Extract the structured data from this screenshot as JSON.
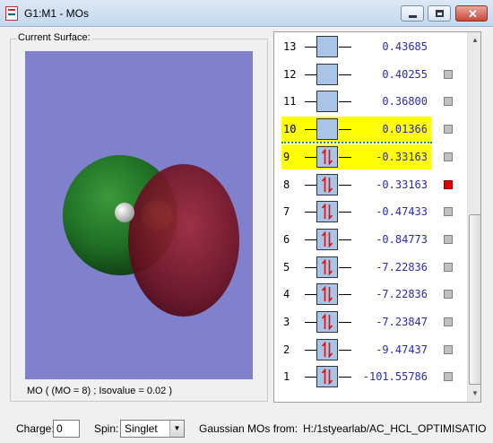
{
  "window": {
    "title": "G1:M1 - MOs"
  },
  "surface": {
    "legend": "Current Surface:",
    "caption": "MO ( (MO = 8) ; Isovalue = 0.02 )",
    "background_color": "#8080cc"
  },
  "orbitals": [
    {
      "num": "13",
      "energy": "0.43685",
      "occupied": false,
      "highlight": false,
      "selected": false,
      "marker": false
    },
    {
      "num": "12",
      "energy": "0.40255",
      "occupied": false,
      "highlight": false,
      "selected": false,
      "marker": true
    },
    {
      "num": "11",
      "energy": "0.36800",
      "occupied": false,
      "highlight": false,
      "selected": false,
      "marker": true
    },
    {
      "num": "10",
      "energy": "0.01366",
      "occupied": false,
      "highlight": true,
      "selected": false,
      "marker": true
    },
    {
      "num": "9",
      "energy": "-0.33163",
      "occupied": true,
      "highlight": true,
      "selected": false,
      "marker": true
    },
    {
      "num": "8",
      "energy": "-0.33163",
      "occupied": true,
      "highlight": false,
      "selected": true,
      "marker": true
    },
    {
      "num": "7",
      "energy": "-0.47433",
      "occupied": true,
      "highlight": false,
      "selected": false,
      "marker": true
    },
    {
      "num": "6",
      "energy": "-0.84773",
      "occupied": true,
      "highlight": false,
      "selected": false,
      "marker": true
    },
    {
      "num": "5",
      "energy": "-7.22836",
      "occupied": true,
      "highlight": false,
      "selected": false,
      "marker": true
    },
    {
      "num": "4",
      "energy": "-7.22836",
      "occupied": true,
      "highlight": false,
      "selected": false,
      "marker": true
    },
    {
      "num": "3",
      "energy": "-7.23847",
      "occupied": true,
      "highlight": false,
      "selected": false,
      "marker": true
    },
    {
      "num": "2",
      "energy": "-9.47437",
      "occupied": true,
      "highlight": false,
      "selected": false,
      "marker": true
    },
    {
      "num": "1",
      "energy": "-101.55786",
      "occupied": true,
      "highlight": false,
      "selected": false,
      "marker": true
    }
  ],
  "footer": {
    "charge_label": "Charge:",
    "charge_value": "0",
    "spin_label": "Spin:",
    "spin_value": "Singlet",
    "source_label": "Gaussian MOs from:",
    "source_path": "H:/1styearlab/AC_HCL_OPTIMISATIO"
  },
  "colors": {
    "highlight": "#ffff00",
    "energy_text": "#2a2ab8",
    "selected_marker": "#e00000",
    "orbital_box": "#a8c4e6",
    "homo_lumo_divider": "#20a020"
  }
}
